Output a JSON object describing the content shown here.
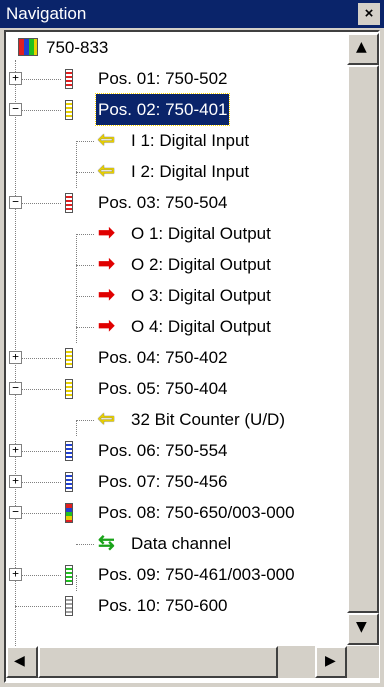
{
  "window": {
    "title": "Navigation",
    "close_glyph": "×"
  },
  "colors": {
    "title_bar": "#0a246a",
    "selection": "#0a246a",
    "input_arrow": "#e8d000",
    "output_arrow": "#e00000"
  },
  "tree": {
    "root": {
      "label": "750-833",
      "icon": "coupler-icon"
    },
    "nodes": [
      {
        "label": "Pos. 01: 750-502",
        "state": "collapsed",
        "color": "red"
      },
      {
        "label": "Pos. 02: 750-401",
        "state": "expanded",
        "color": "yellow",
        "selected": true,
        "children": [
          {
            "label": "I 1: Digital Input",
            "icon": "input-arrow-icon"
          },
          {
            "label": "I 2: Digital Input",
            "icon": "input-arrow-icon"
          }
        ]
      },
      {
        "label": "Pos. 03: 750-504",
        "state": "expanded",
        "color": "red",
        "children": [
          {
            "label": "O 1: Digital Output",
            "icon": "output-arrow-icon"
          },
          {
            "label": "O 2: Digital Output",
            "icon": "output-arrow-icon"
          },
          {
            "label": "O 3: Digital Output",
            "icon": "output-arrow-icon"
          },
          {
            "label": "O 4: Digital Output",
            "icon": "output-arrow-icon"
          }
        ]
      },
      {
        "label": "Pos. 04: 750-402",
        "state": "collapsed",
        "color": "yellow"
      },
      {
        "label": "Pos. 05: 750-404",
        "state": "expanded",
        "color": "yellow",
        "children": [
          {
            "label": "32 Bit Counter (U/D)",
            "icon": "input-arrow-icon"
          }
        ]
      },
      {
        "label": "Pos. 06: 750-554",
        "state": "collapsed",
        "color": "blue"
      },
      {
        "label": "Pos. 07: 750-456",
        "state": "collapsed",
        "color": "blue"
      },
      {
        "label": "Pos. 08: 750-650/003-000",
        "state": "expanded",
        "color": "multi",
        "children": [
          {
            "label": "Data channel",
            "icon": "data-channel-icon"
          }
        ]
      },
      {
        "label": "Pos. 09: 750-461/003-000",
        "state": "collapsed",
        "color": "green"
      },
      {
        "label": "Pos. 10: 750-600",
        "state": "leaf",
        "color": "gray"
      }
    ]
  },
  "scrollbars": {
    "vertical": {
      "up": "▲",
      "down": "▼"
    },
    "horizontal": {
      "left": "◀",
      "right": "▶"
    }
  }
}
